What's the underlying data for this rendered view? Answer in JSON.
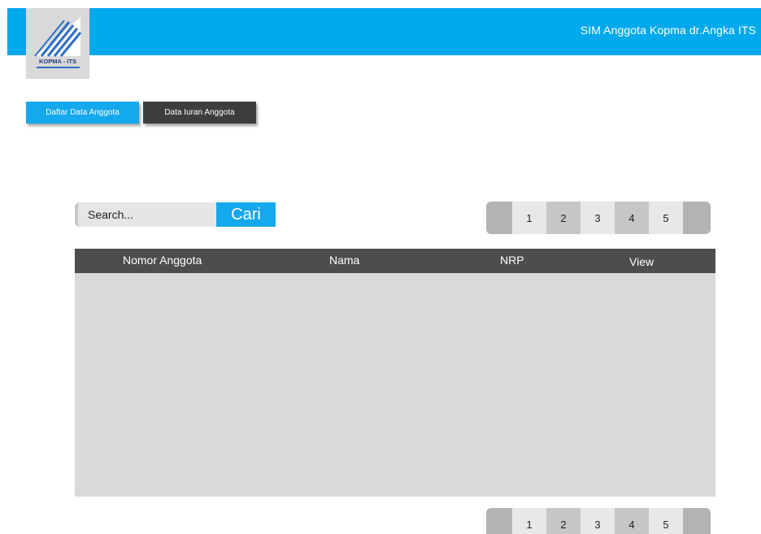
{
  "header": {
    "app_title": "SIM Anggota Kopma dr.Angka ITS",
    "accent_color": "#00a8ec"
  },
  "logo": {
    "text": "KOPMA - ITS",
    "icon": "kopma-logo-icon"
  },
  "nav": {
    "tabs": [
      {
        "label": "Daftar Data Anggota",
        "active": true
      },
      {
        "label": "Data Iuran Anggota",
        "active": false
      }
    ]
  },
  "search": {
    "placeholder": "Search...",
    "value": "",
    "button_label": "Cari"
  },
  "pagination": {
    "pages": [
      "1",
      "2",
      "3",
      "4",
      "5"
    ]
  },
  "table": {
    "columns": [
      "Nomor Anggota",
      "Nama",
      "NRP",
      "View"
    ],
    "rows": []
  }
}
